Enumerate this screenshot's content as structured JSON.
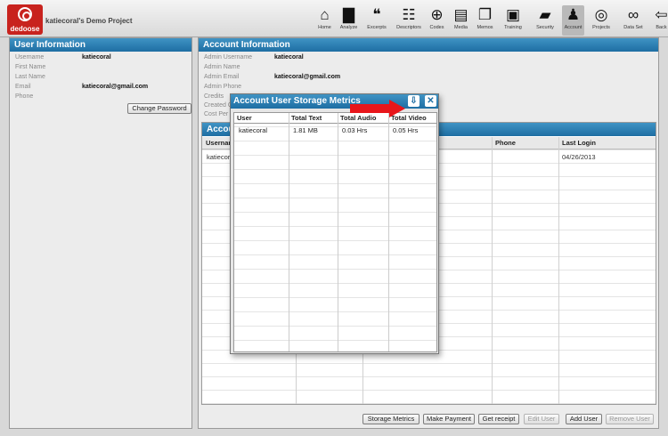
{
  "app": {
    "logo_text": "dedoose",
    "project_title": "katiecoral's Demo Project"
  },
  "nav": [
    {
      "label": "Home",
      "icon": "house-icon",
      "glyph": "⌂"
    },
    {
      "label": "Analyze",
      "icon": "bar-chart-icon",
      "glyph": "▇"
    },
    {
      "label": "Excerpts",
      "icon": "speech-bubble-icon",
      "glyph": "❝"
    },
    {
      "label": "Descriptors",
      "icon": "clipboard-icon",
      "glyph": "☷"
    },
    {
      "label": "Codes",
      "icon": "plus-circle-icon",
      "glyph": "⊕"
    },
    {
      "label": "Media",
      "icon": "media-icon",
      "glyph": "▤"
    },
    {
      "label": "Memos",
      "icon": "scroll-icon",
      "glyph": "❐"
    },
    {
      "label": "Training",
      "icon": "training-icon",
      "glyph": "▣"
    },
    {
      "label": "Security",
      "icon": "lock-icon",
      "glyph": "▰"
    },
    {
      "label": "Account",
      "icon": "account-icon",
      "glyph": "♟"
    },
    {
      "label": "Projects",
      "icon": "globe-icon",
      "glyph": "◎"
    },
    {
      "label": "Data Set",
      "icon": "binoculars-icon",
      "glyph": "∞"
    },
    {
      "label": "Back",
      "icon": "back-arrow-icon",
      "glyph": "⇦"
    }
  ],
  "user_info": {
    "title": "User Information",
    "fields": [
      {
        "label": "Username",
        "value": "katiecoral"
      },
      {
        "label": "First Name",
        "value": ""
      },
      {
        "label": "Last Name",
        "value": ""
      },
      {
        "label": "Email",
        "value": "katiecoral@gmail.com"
      },
      {
        "label": "Phone",
        "value": ""
      }
    ],
    "change_password": "Change Password"
  },
  "account_info": {
    "title": "Account Information",
    "fields": [
      {
        "label": "Admin Username",
        "value": "katiecoral"
      },
      {
        "label": "Admin Name",
        "value": ""
      },
      {
        "label": "Admin Email",
        "value": "katiecoral@gmail.com"
      },
      {
        "label": "Admin Phone",
        "value": ""
      },
      {
        "label": "Credits",
        "value": ""
      },
      {
        "label": "Created O",
        "value": ""
      },
      {
        "label": "Cost Per",
        "value": ""
      }
    ]
  },
  "account_users": {
    "title": "Accoun",
    "columns": {
      "username": "Usernam",
      "phone": "Phone",
      "last_login": "Last Login"
    },
    "rows": [
      {
        "username": "katiecora",
        "phone": "",
        "last_login": "04/26/2013"
      }
    ]
  },
  "buttons": {
    "storage_metrics": "Storage Metrics",
    "make_payment": "Make Payment",
    "get_receipt": "Get receipt",
    "edit_user": "Edit User",
    "add_user": "Add User",
    "remove_user": "Remove User"
  },
  "modal": {
    "title": "Account User Storage Metrics",
    "columns": [
      "User",
      "Total Text",
      "Total Audio",
      "Total Video"
    ],
    "rows": [
      {
        "user": "katiecoral",
        "text": "1.81 MB",
        "audio": "0.03 Hrs",
        "video": "0.05 Hrs"
      }
    ]
  },
  "colors": {
    "header_blue": "#1e6ea3",
    "logo_red": "#c8231e",
    "arrow_red": "#e8161b"
  }
}
